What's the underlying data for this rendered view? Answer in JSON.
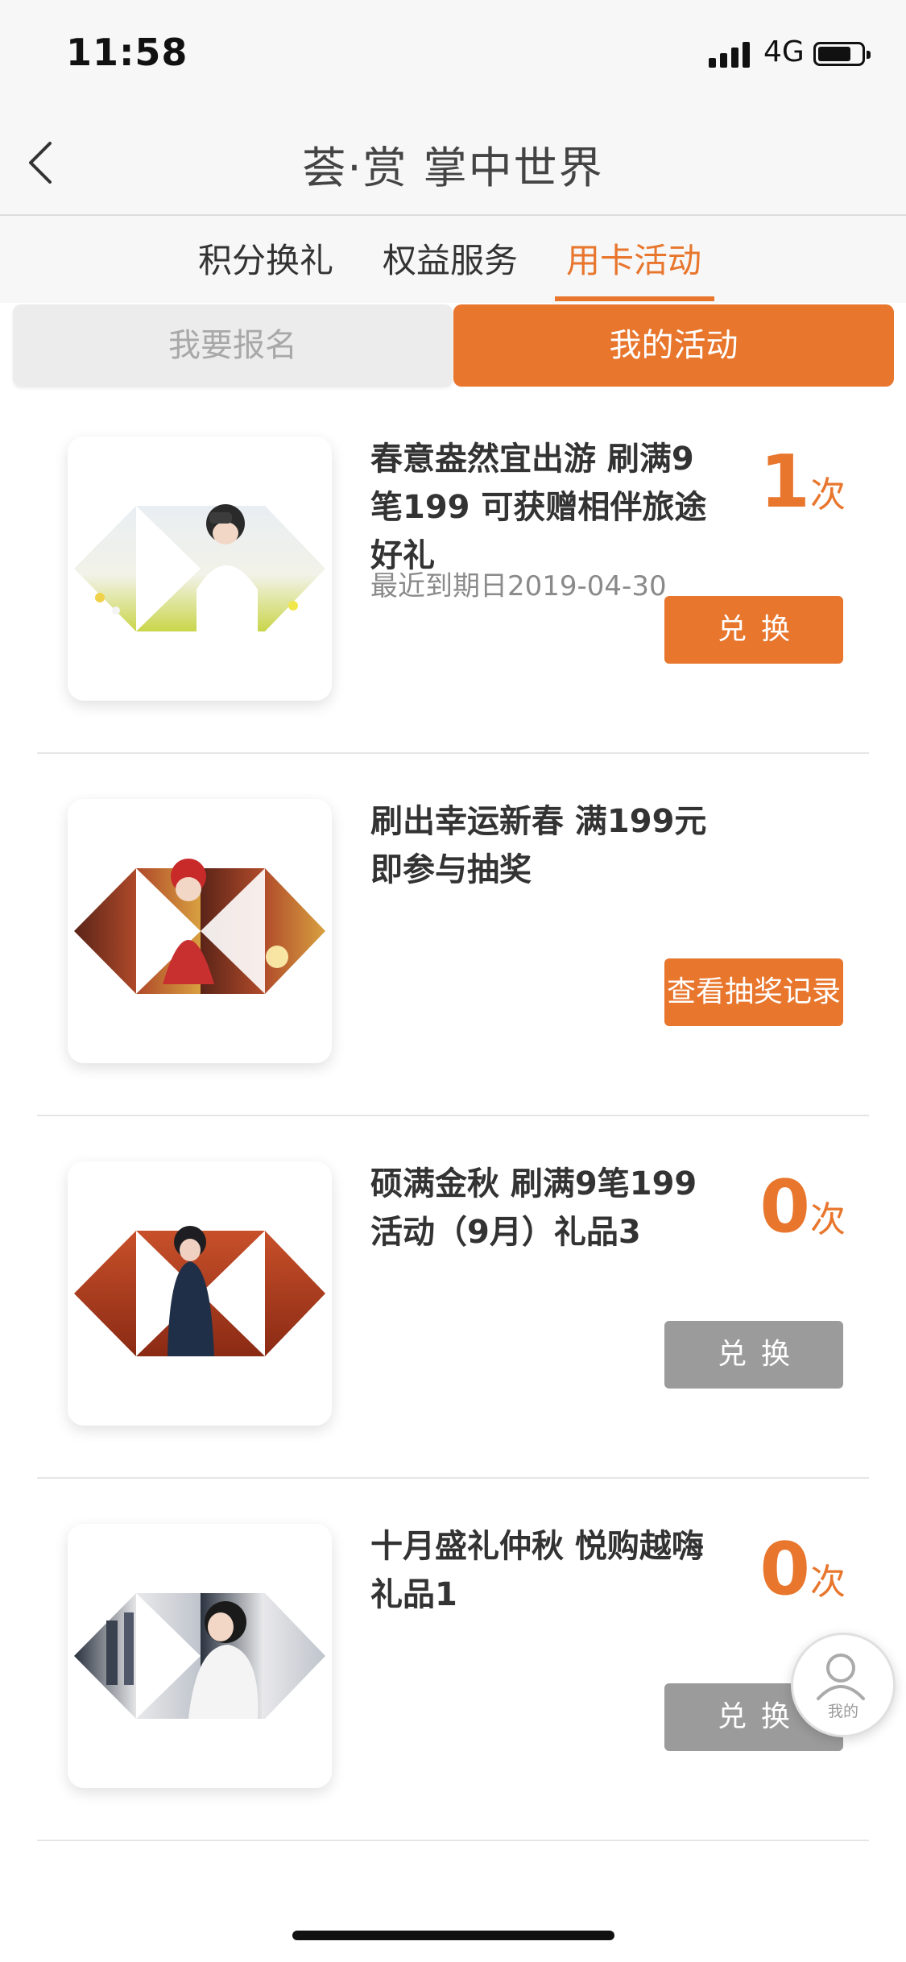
{
  "status_bar": {
    "time": "11:58",
    "network": "4G"
  },
  "nav": {
    "title": "荟·赏 掌中世界"
  },
  "tabs": [
    {
      "label": "积分换礼",
      "active": false
    },
    {
      "label": "权益服务",
      "active": false
    },
    {
      "label": "用卡活动",
      "active": true
    }
  ],
  "segments": {
    "left": "我要报名",
    "right": "我的活动",
    "selected": "right"
  },
  "activities": [
    {
      "title": "春意盎然宜出游 刷满9笔199 可获赠相伴旅途好礼",
      "expiry": "最近到期日2019-04-30",
      "count": "1",
      "unit": "次",
      "button": "兑换",
      "button_style": "orange"
    },
    {
      "title": "刷出幸运新春 满199元即参与抽奖",
      "button": "查看抽奖记录",
      "button_style": "orange"
    },
    {
      "title": "硕满金秋 刷满9笔199活动（9月）礼品3",
      "count": "0",
      "unit": "次",
      "button": "兑换",
      "button_style": "gray"
    },
    {
      "title": "十月盛礼仲秋 悦购越嗨礼品1",
      "count": "0",
      "unit": "次",
      "button": "兑换",
      "button_style": "gray"
    }
  ],
  "fab": {
    "label": "我的"
  },
  "colors": {
    "accent": "#e8762d",
    "disabled_button": "#9b9b9b",
    "segment_inactive_bg": "#ececec"
  }
}
